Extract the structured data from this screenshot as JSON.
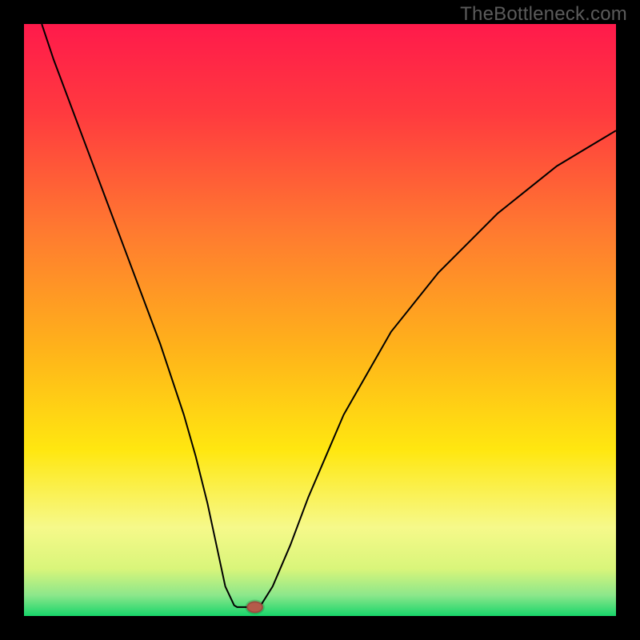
{
  "watermark": "TheBottleneck.com",
  "chart_data": {
    "type": "line",
    "title": "",
    "xlabel": "",
    "ylabel": "",
    "xlim": [
      0,
      100
    ],
    "ylim": [
      0,
      100
    ],
    "gradient_stops": [
      {
        "offset": 0.0,
        "color": "#ff1a4b"
      },
      {
        "offset": 0.15,
        "color": "#ff3a3f"
      },
      {
        "offset": 0.35,
        "color": "#ff7a30"
      },
      {
        "offset": 0.55,
        "color": "#ffb31a"
      },
      {
        "offset": 0.72,
        "color": "#ffe710"
      },
      {
        "offset": 0.85,
        "color": "#f6f98a"
      },
      {
        "offset": 0.92,
        "color": "#d9f57a"
      },
      {
        "offset": 0.965,
        "color": "#8ce78b"
      },
      {
        "offset": 1.0,
        "color": "#18d56a"
      }
    ],
    "series": [
      {
        "name": "bottleneck-curve",
        "x": [
          3,
          5,
          8,
          11,
          14,
          17,
          20,
          23,
          25,
          27,
          29,
          31,
          32.5,
          34,
          35.5,
          36,
          36.5,
          39,
          40,
          42,
          45,
          48,
          51,
          54,
          58,
          62,
          66,
          70,
          75,
          80,
          85,
          90,
          95,
          100
        ],
        "y": [
          100,
          94,
          86,
          78,
          70,
          62,
          54,
          46,
          40,
          34,
          27,
          19,
          12,
          5,
          1.8,
          1.5,
          1.5,
          1.5,
          1.8,
          5,
          12,
          20,
          27,
          34,
          41,
          48,
          53,
          58,
          63,
          68,
          72,
          76,
          79,
          82
        ]
      }
    ],
    "marker": {
      "x": 39,
      "y": 1.5,
      "rx": 1.4,
      "ry": 1.0,
      "name": "optimal-point"
    },
    "colors": {
      "curve_stroke": "#000000",
      "background_border": "#000000"
    }
  }
}
